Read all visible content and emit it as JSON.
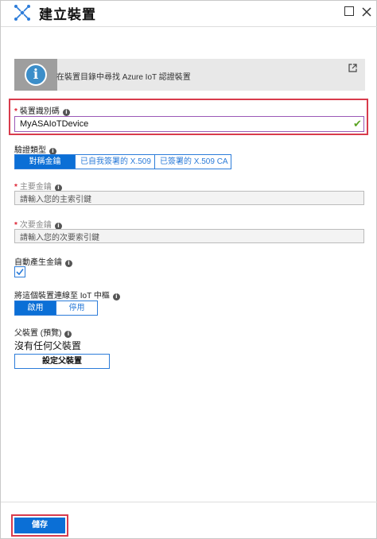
{
  "header": {
    "title": "建立裝置",
    "icon": "device-network-icon"
  },
  "info": {
    "text": "在裝置目錄中尋找 Azure IoT 認證裝置",
    "icon": "info-icon"
  },
  "device_id": {
    "label": "裝置識別碼",
    "required_mark": "*",
    "value": "MyASAIoTDevice"
  },
  "auth": {
    "label": "驗證類型",
    "options": [
      "對稱金鑰",
      "已自我簽署的 X.509",
      "已簽署的 X.509 CA"
    ],
    "selected": "對稱金鑰"
  },
  "primary_key": {
    "label": "主要金鑰",
    "required_mark": "*",
    "placeholder": "請輸入您的主索引鍵"
  },
  "secondary_key": {
    "label": "次要金鑰",
    "required_mark": "*",
    "placeholder": "請輸入您的次要索引鍵"
  },
  "auto_keys": {
    "label": "自動產生金鑰",
    "checked": true
  },
  "connect": {
    "label": "將這個裝置連線至 IoT 中樞",
    "options": [
      "啟用",
      "停用"
    ],
    "selected": "啟用"
  },
  "parent": {
    "label": "父裝置 (預覽)",
    "value": "沒有任何父裝置",
    "button": "設定父裝置"
  },
  "footer": {
    "save": "儲存"
  },
  "colors": {
    "accent": "#0b6fd6",
    "highlight": "#d83b4c",
    "valid": "#5aa323"
  }
}
